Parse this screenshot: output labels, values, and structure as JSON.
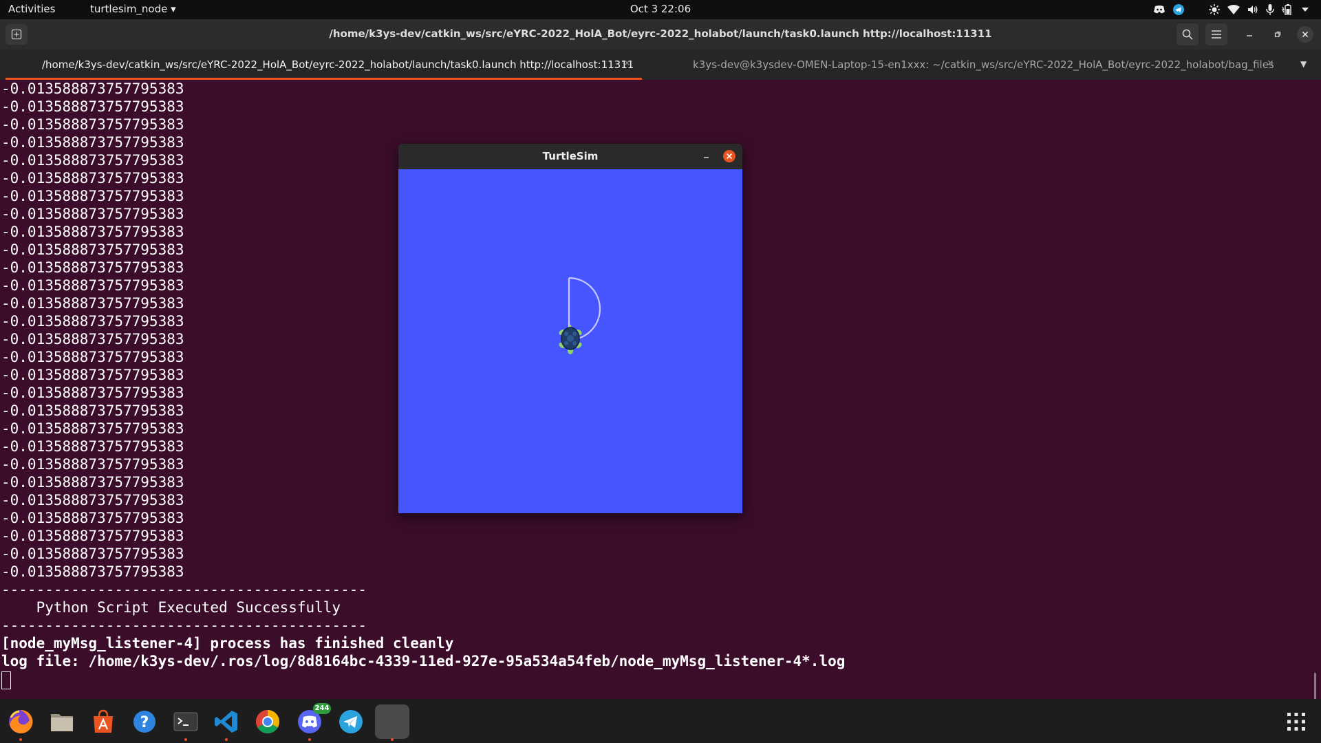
{
  "topbar": {
    "activities": "Activities",
    "app_menu": "turtlesim_node ▾",
    "clock": "Oct 3  22:06"
  },
  "terminal_window": {
    "title": "/home/k3ys-dev/catkin_ws/src/eYRC-2022_HolA_Bot/eyrc-2022_holabot/launch/task0.launch http://localhost:11311",
    "tabs": [
      {
        "label": "/home/k3ys-dev/catkin_ws/src/eYRC-2022_HolA_Bot/eyrc-2022_holabot/launch/task0.launch http://localhost:11311",
        "close": "✕"
      },
      {
        "label": "k3ys-dev@k3ysdev-OMEN-Laptop-15-en1xxx: ~/catkin_ws/src/eYRC-2022_HolA_Bot/eyrc-2022_holabot/bag_files",
        "close": "✕"
      }
    ],
    "tabs_menu": "▼"
  },
  "terminal": {
    "lines": [
      "-0.013588873757795383",
      "-0.013588873757795383",
      "-0.013588873757795383",
      "-0.013588873757795383",
      "-0.013588873757795383",
      "-0.013588873757795383",
      "-0.013588873757795383",
      "-0.013588873757795383",
      "-0.013588873757795383",
      "-0.013588873757795383",
      "-0.013588873757795383",
      "-0.013588873757795383",
      "-0.013588873757795383",
      "-0.013588873757795383",
      "-0.013588873757795383",
      "-0.013588873757795383",
      "-0.013588873757795383",
      "-0.013588873757795383",
      "-0.013588873757795383",
      "-0.013588873757795383",
      "-0.013588873757795383",
      "-0.013588873757795383",
      "-0.013588873757795383",
      "-0.013588873757795383",
      "-0.013588873757795383",
      "-0.013588873757795383",
      "-0.013588873757795383",
      "-0.013588873757795383",
      "------------------------------------------",
      "    Python Script Executed Successfully",
      "------------------------------------------",
      "[node_myMsg_listener-4] process has finished cleanly",
      "log file: /home/k3ys-dev/.ros/log/8d8164bc-4339-11ed-927e-95a534a54feb/node_myMsg_listener-4*.log"
    ],
    "bold_from_line": 31
  },
  "turtlesim": {
    "title": "TurtleSim",
    "background_color": "#4556ff",
    "pen_color": "#c8c8ff"
  },
  "dock": {
    "items": [
      {
        "name": "firefox-icon",
        "running": true
      },
      {
        "name": "files-icon",
        "running": false
      },
      {
        "name": "app-center-icon",
        "running": false
      },
      {
        "name": "help-icon",
        "running": false
      },
      {
        "name": "terminal-icon",
        "running": true
      },
      {
        "name": "vscode-icon",
        "running": true
      },
      {
        "name": "chrome-icon",
        "running": false
      },
      {
        "name": "discord-icon",
        "running": true,
        "badge": "244"
      },
      {
        "name": "telegram-icon",
        "running": false
      },
      {
        "name": "turtlesim-icon",
        "running": true
      }
    ]
  },
  "colors": {
    "terminal_bg": "#3c0d2b",
    "accent": "#e95420"
  }
}
